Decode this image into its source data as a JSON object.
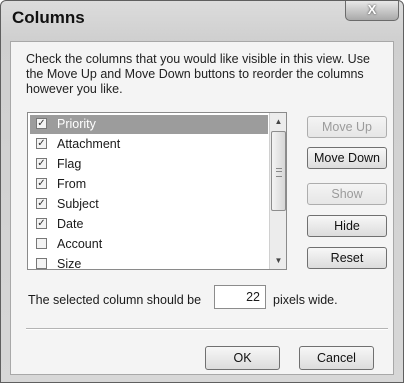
{
  "window": {
    "title": "Columns",
    "close_label": "X"
  },
  "instructions": "Check the columns that you would like visible in this view.  Use the Move Up and Move Down buttons to reorder the columns however you like.",
  "columns": {
    "items": [
      {
        "label": "Priority",
        "checked": true,
        "selected": true
      },
      {
        "label": "Attachment",
        "checked": true,
        "selected": false
      },
      {
        "label": "Flag",
        "checked": true,
        "selected": false
      },
      {
        "label": "From",
        "checked": true,
        "selected": false
      },
      {
        "label": "Subject",
        "checked": true,
        "selected": false
      },
      {
        "label": "Date",
        "checked": true,
        "selected": false
      },
      {
        "label": "Account",
        "checked": false,
        "selected": false
      },
      {
        "label": "Size",
        "checked": false,
        "selected": false
      }
    ]
  },
  "buttons": {
    "move_up": "Move Up",
    "move_down": "Move Down",
    "show": "Show",
    "hide": "Hide",
    "reset": "Reset",
    "ok": "OK",
    "cancel": "Cancel"
  },
  "width_setting": {
    "label": "The selected column should be",
    "value": "22",
    "suffix": "pixels wide."
  },
  "icons": {
    "check": "check-icon",
    "scroll_up": "scroll-up-arrow-icon",
    "scroll_down": "scroll-down-arrow-icon",
    "grip": "scroll-grip-icon"
  }
}
